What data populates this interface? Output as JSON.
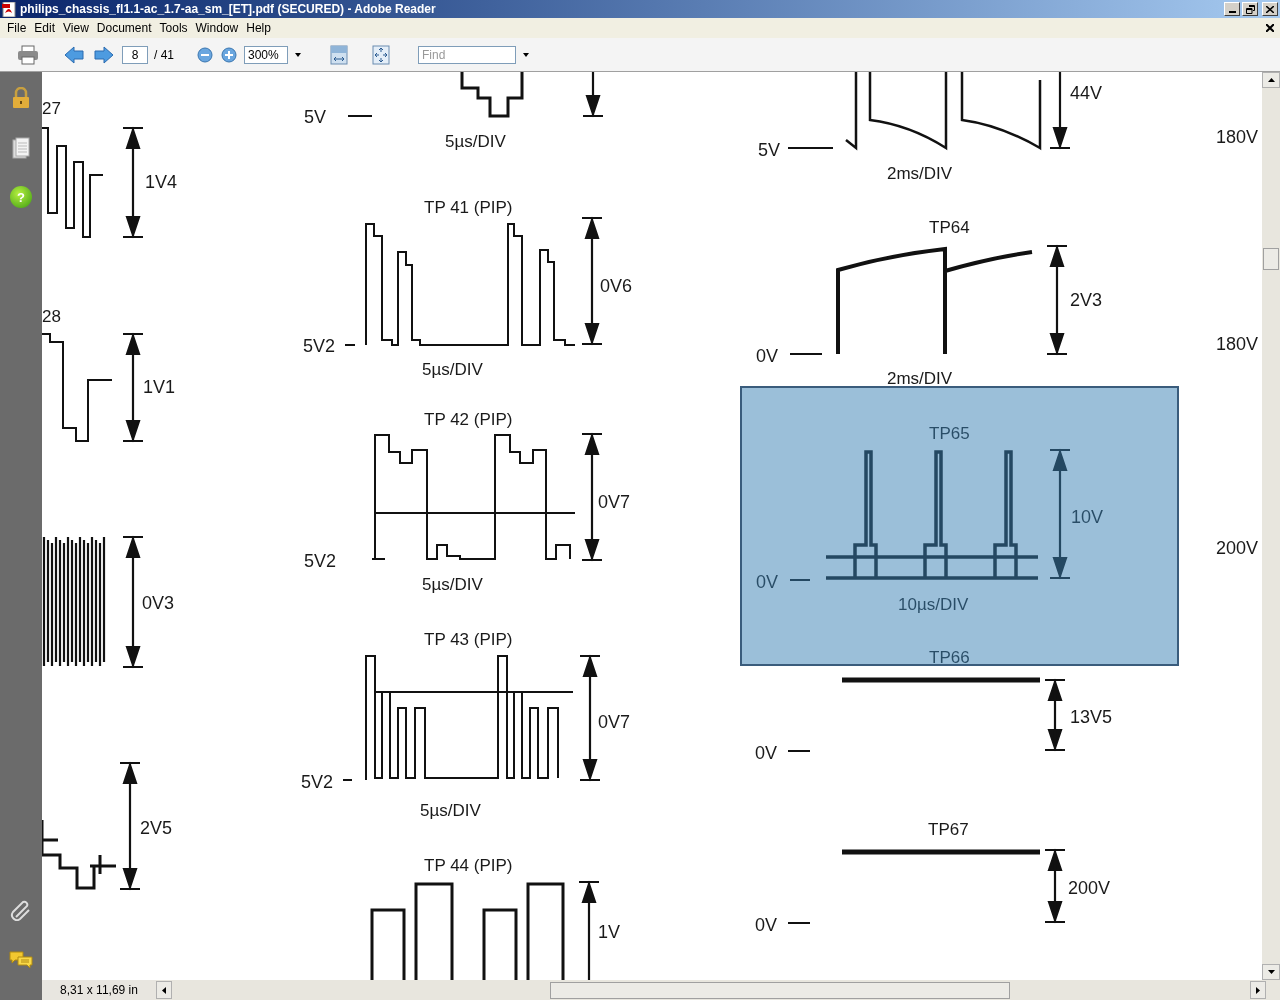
{
  "window": {
    "title": "philips_chassis_fl1.1-ac_1.7-aa_sm_[ET].pdf (SECURED) - Adobe Reader"
  },
  "menu": [
    "File",
    "Edit",
    "View",
    "Document",
    "Tools",
    "Window",
    "Help"
  ],
  "toolbar": {
    "page": "8",
    "page_count": "/ 41",
    "zoom": "300%",
    "find_placeholder": "Find"
  },
  "side_panel": {
    "help_glyph": "?"
  },
  "plots": [
    {
      "title": "27",
      "amplitude": "1V4",
      "highlighted": false
    },
    {
      "title": "28",
      "amplitude": "1V1",
      "highlighted": false
    },
    {
      "amplitude": "0V3",
      "highlighted": false
    },
    {
      "amplitude": "2V5",
      "highlighted": false
    },
    {
      "reference": "5V",
      "timebase": "5µs/DIV",
      "highlighted": false
    },
    {
      "title": "TP 41 (PIP)",
      "reference": "5V2",
      "amplitude": "0V6",
      "timebase": "5µs/DIV",
      "highlighted": false
    },
    {
      "title": "TP 42 (PIP)",
      "reference": "5V2",
      "amplitude": "0V7",
      "timebase": "5µs/DIV",
      "highlighted": false
    },
    {
      "title": "TP 43 (PIP)",
      "reference": "5V2",
      "amplitude": "0V7",
      "timebase": "5µs/DIV",
      "highlighted": false
    },
    {
      "title": "TP 44 (PIP)",
      "amplitude": "1V",
      "highlighted": false
    },
    {
      "reference": "5V",
      "amplitude": "44V",
      "timebase": "2ms/DIV",
      "highlighted": false
    },
    {
      "title": "TP64",
      "reference": "0V",
      "amplitude": "2V3",
      "timebase": "2ms/DIV",
      "highlighted": false
    },
    {
      "title": "TP65",
      "reference": "0V",
      "amplitude": "10V",
      "timebase": "10µs/DIV",
      "highlighted": true
    },
    {
      "title": "TP66",
      "reference": "0V",
      "amplitude": "13V5",
      "highlighted": false
    },
    {
      "title": "TP67",
      "reference": "0V",
      "amplitude": "200V",
      "highlighted": false
    }
  ],
  "edge_labels": [
    "180V",
    "180V",
    "200V"
  ],
  "status_bar": {
    "page_size": "8,31 x 11,69 in"
  }
}
